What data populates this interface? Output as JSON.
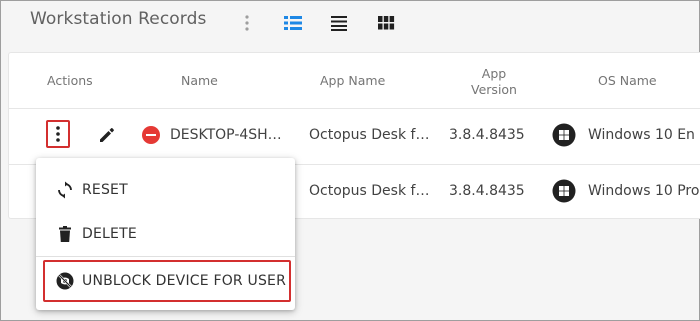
{
  "header": {
    "title": "Workstation Records",
    "icons": [
      "more-vert",
      "view-list",
      "view-rows",
      "view-grid"
    ],
    "accent": "#1e88e5"
  },
  "table": {
    "columns": {
      "actions": "Actions",
      "name": "Name",
      "app_name": "App Name",
      "app_version_line1": "App",
      "app_version_line2": "Version",
      "os_name": "OS Name"
    },
    "rows": [
      {
        "name": "DESKTOP-4SH…",
        "app_name": "Octopus Desk f…",
        "app_version": "3.8.4.8435",
        "os_name": "Windows 10 En",
        "status": "blocked"
      },
      {
        "name": "",
        "app_name": "Octopus Desk f…",
        "app_version": "3.8.4.8435",
        "os_name": "Windows 10 Pro"
      }
    ]
  },
  "context_menu": {
    "items": [
      {
        "label": "RESET",
        "icon": "refresh-icon"
      },
      {
        "label": "DELETE",
        "icon": "trash-icon"
      },
      {
        "label": "UNBLOCK DEVICE FOR USER",
        "icon": "unblock-icon"
      }
    ]
  },
  "colors": {
    "highlight": "#d32f2f",
    "blocked": "#e53935"
  }
}
